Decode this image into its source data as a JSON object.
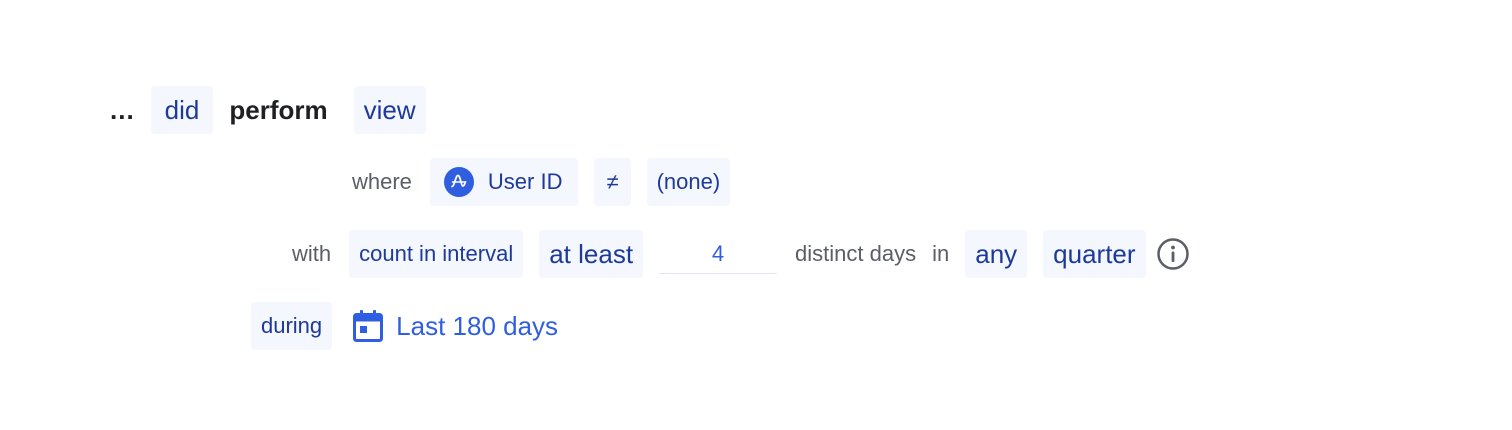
{
  "row1": {
    "ellipsis": "...",
    "did": "did",
    "perform": "perform",
    "event": "view"
  },
  "row2": {
    "where": "where",
    "property": "User ID",
    "property_icon": "amplitude-logo-icon",
    "operator": "≠",
    "value": "(none)"
  },
  "row3": {
    "with": "with",
    "mode": "count in interval",
    "comparator": "at least",
    "count": "4",
    "unit": "distinct days",
    "in": "in",
    "any": "any",
    "interval": "quarter",
    "info_icon": "info-circle-icon"
  },
  "row4": {
    "during": "during",
    "date_icon": "calendar-icon",
    "date_range": "Last 180 days"
  },
  "colors": {
    "chip_bg": "#f4f7fd",
    "chip_text": "#1d3a9a",
    "accent": "#2f5ee0",
    "label": "#5b5e66",
    "strong": "#1f2024"
  }
}
